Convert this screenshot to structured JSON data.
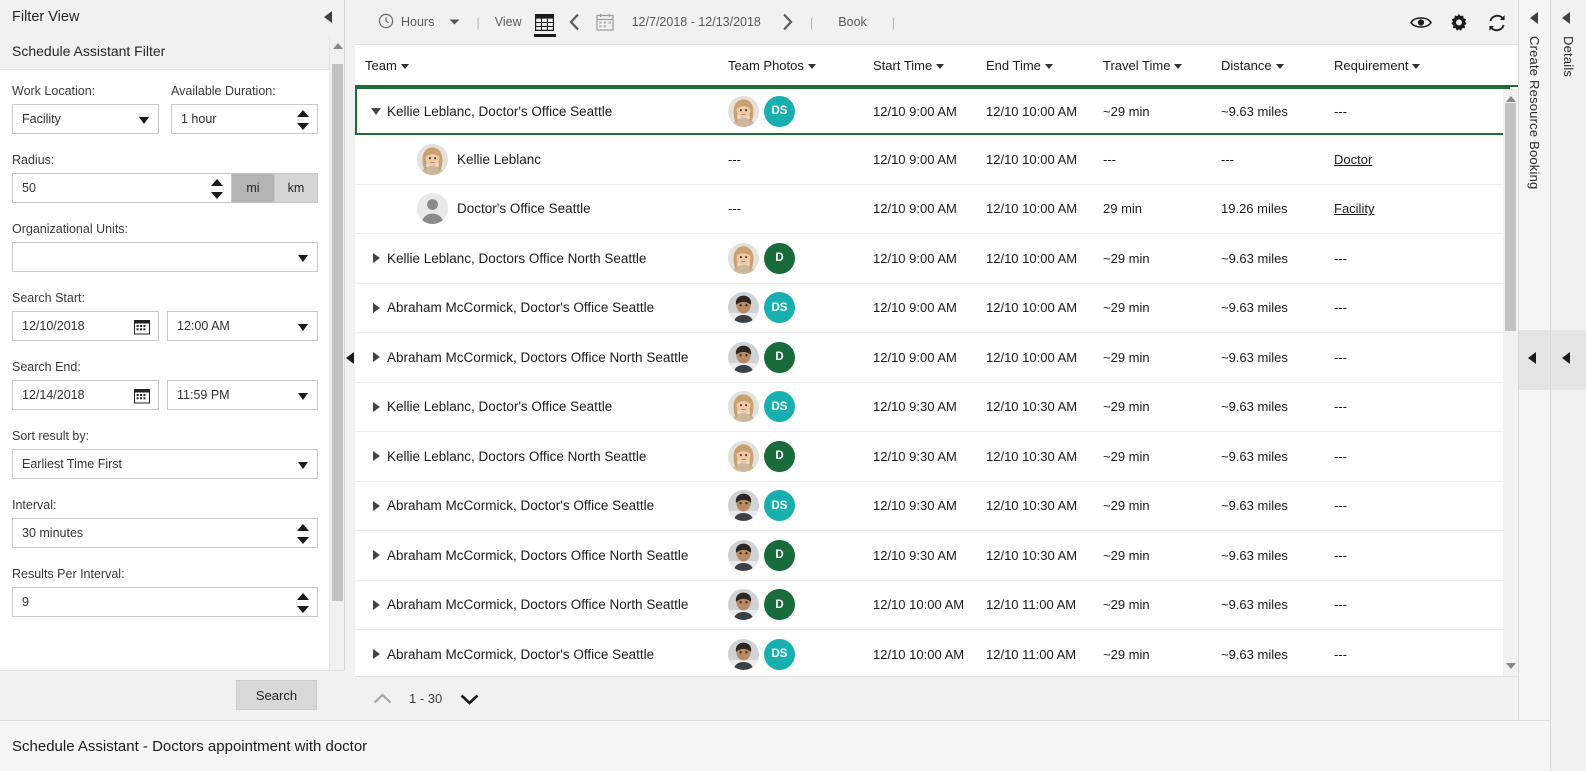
{
  "filter_panel": {
    "title": "Filter View",
    "subtitle": "Schedule Assistant Filter",
    "fields": {
      "work_location_label": "Work Location:",
      "work_location_value": "Facility",
      "available_duration_label": "Available Duration:",
      "available_duration_value": "1 hour",
      "radius_label": "Radius:",
      "radius_value": "50",
      "unit_mi": "mi",
      "unit_km": "km",
      "org_units_label": "Organizational Units:",
      "org_units_value": "",
      "search_start_label": "Search Start:",
      "search_start_date": "12/10/2018",
      "search_start_time": "12:00 AM",
      "search_end_label": "Search End:",
      "search_end_date": "12/14/2018",
      "search_end_time": "11:59 PM",
      "sort_label": "Sort result by:",
      "sort_value": "Earliest Time First",
      "interval_label": "Interval:",
      "interval_value": "30 minutes",
      "results_per_interval_label": "Results Per Interval:",
      "results_per_interval_value": "9"
    },
    "search_button": "Search"
  },
  "toolbar": {
    "hours_label": "Hours",
    "view_label": "View",
    "date_range": "12/7/2018 - 12/13/2018",
    "book_label": "Book",
    "separator": "|"
  },
  "table": {
    "columns": [
      "Team",
      "Team Photos",
      "Start Time",
      "End Time",
      "Travel Time",
      "Distance",
      "Requirement"
    ],
    "rows": [
      {
        "team": "Kellie Leblanc, Doctor's Office Seattle",
        "expanded": true,
        "selected": true,
        "badge": "DS",
        "badge_color": "#18b0ae",
        "avatar": "female",
        "start": "12/10 9:00 AM",
        "end": "12/10 10:00 AM",
        "travel": "~29 min",
        "distance": "~9.63 miles",
        "requirement": "---",
        "children": [
          {
            "name": "Kellie Leblanc",
            "avatar": "female",
            "photos": "---",
            "start": "12/10 9:00 AM",
            "end": "12/10 10:00 AM",
            "travel": "---",
            "distance": "---",
            "requirement": "Doctor"
          },
          {
            "name": "Doctor's Office Seattle",
            "avatar": "placeholder",
            "photos": "---",
            "start": "12/10 9:00 AM",
            "end": "12/10 10:00 AM",
            "travel": "29 min",
            "distance": "19.26 miles",
            "requirement": "Facility"
          }
        ]
      },
      {
        "team": "Kellie Leblanc, Doctors Office North Seattle",
        "expanded": false,
        "selected": false,
        "badge": "D",
        "badge_color": "#186b3a",
        "avatar": "female",
        "start": "12/10 9:00 AM",
        "end": "12/10 10:00 AM",
        "travel": "~29 min",
        "distance": "~9.63 miles",
        "requirement": "---"
      },
      {
        "team": "Abraham McCormick, Doctor's Office Seattle",
        "expanded": false,
        "selected": false,
        "badge": "DS",
        "badge_color": "#18b0ae",
        "avatar": "male",
        "start": "12/10 9:00 AM",
        "end": "12/10 10:00 AM",
        "travel": "~29 min",
        "distance": "~9.63 miles",
        "requirement": "---"
      },
      {
        "team": "Abraham McCormick, Doctors Office North Seattle",
        "expanded": false,
        "selected": false,
        "badge": "D",
        "badge_color": "#186b3a",
        "avatar": "male",
        "start": "12/10 9:00 AM",
        "end": "12/10 10:00 AM",
        "travel": "~29 min",
        "distance": "~9.63 miles",
        "requirement": "---"
      },
      {
        "team": "Kellie Leblanc, Doctor's Office Seattle",
        "expanded": false,
        "selected": false,
        "badge": "DS",
        "badge_color": "#18b0ae",
        "avatar": "female",
        "start": "12/10 9:30 AM",
        "end": "12/10 10:30 AM",
        "travel": "~29 min",
        "distance": "~9.63 miles",
        "requirement": "---"
      },
      {
        "team": "Kellie Leblanc, Doctors Office North Seattle",
        "expanded": false,
        "selected": false,
        "badge": "D",
        "badge_color": "#186b3a",
        "avatar": "female",
        "start": "12/10 9:30 AM",
        "end": "12/10 10:30 AM",
        "travel": "~29 min",
        "distance": "~9.63 miles",
        "requirement": "---"
      },
      {
        "team": "Abraham McCormick, Doctor's Office Seattle",
        "expanded": false,
        "selected": false,
        "badge": "DS",
        "badge_color": "#18b0ae",
        "avatar": "male",
        "start": "12/10 9:30 AM",
        "end": "12/10 10:30 AM",
        "travel": "~29 min",
        "distance": "~9.63 miles",
        "requirement": "---"
      },
      {
        "team": "Abraham McCormick, Doctors Office North Seattle",
        "expanded": false,
        "selected": false,
        "badge": "D",
        "badge_color": "#186b3a",
        "avatar": "male",
        "start": "12/10 9:30 AM",
        "end": "12/10 10:30 AM",
        "travel": "~29 min",
        "distance": "~9.63 miles",
        "requirement": "---"
      },
      {
        "team": "Abraham McCormick, Doctors Office North Seattle",
        "expanded": false,
        "selected": false,
        "badge": "D",
        "badge_color": "#186b3a",
        "avatar": "male",
        "start": "12/10 10:00 AM",
        "end": "12/10 11:00 AM",
        "travel": "~29 min",
        "distance": "~9.63 miles",
        "requirement": "---"
      },
      {
        "team": "Abraham McCormick, Doctor's Office Seattle",
        "expanded": false,
        "selected": false,
        "badge": "DS",
        "badge_color": "#18b0ae",
        "avatar": "male",
        "start": "12/10 10:00 AM",
        "end": "12/10 11:00 AM",
        "travel": "~29 min",
        "distance": "~9.63 miles",
        "requirement": "---"
      }
    ]
  },
  "pager": {
    "range": "1 - 30"
  },
  "right_panels": {
    "create_resource_booking": "Create Resource Booking",
    "details": "Details"
  },
  "footer": {
    "text": "Schedule Assistant - Doctors appointment with doctor"
  },
  "colors": {
    "accent_green": "#1e6b33",
    "badge_teal": "#18b0ae",
    "badge_green": "#186b3a"
  }
}
